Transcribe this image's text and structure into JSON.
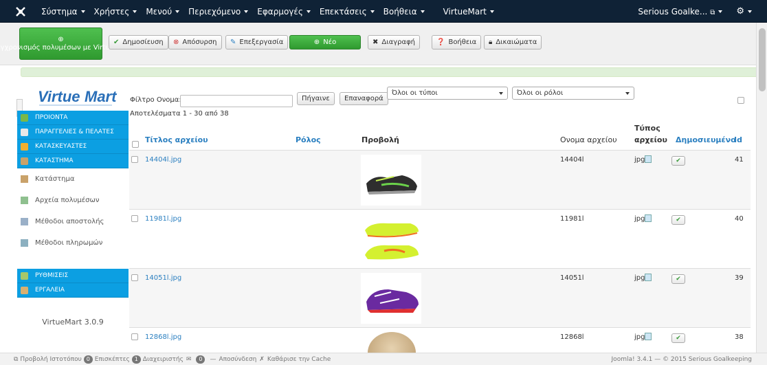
{
  "topbar": {
    "menu": [
      "Σύστημα",
      "Χρήστες",
      "Μενού",
      "Περιεχόμενο",
      "Εφαρμογές",
      "Επεκτάσεις",
      "Βοήθεια",
      "VirtueMart"
    ],
    "user": "Serious Goalke...",
    "colors": {
      "bar": "#0f2236"
    }
  },
  "toolbar": {
    "sync_label": "Συγχρονισμός πολυμέσων με VirtueMart",
    "publish": "Δημοσίευση",
    "unpublish": "Απόσυρση",
    "edit": "Επεξεργασία",
    "new": "Νέο",
    "delete": "Διαγραφή",
    "help": "Βοήθεια",
    "permissions": "Δικαιώματα"
  },
  "sidebar": {
    "logo": "VirtueMart",
    "sections": [
      "ΠΡΟΙΟΝΤΑ",
      "ΠΑΡΑΓΓΕΛΙΕΣ & ΠΕΛΑΤΕΣ",
      "ΚΑΤΑΣΚΕΥΑΣΤΕΣ",
      "ΚΑΤΑΣΤΗΜΑ"
    ],
    "store_items": [
      "Κατάστημα",
      "Αρχεία πολυμέσων",
      "Μέθοδοι αποστολής",
      "Μέθοδοι πληρωμών"
    ],
    "bottom_sections": [
      "ΡΥΘΜΙΣΕΙΣ",
      "ΕΡΓΑΛΕΙΑ"
    ],
    "version": "VirtueMart 3.0.9",
    "accent": "#0c9fe2"
  },
  "filter": {
    "label": "Φίλτρο Ονομα:",
    "value": "",
    "go": "Πήγαινε",
    "reset": "Επαναφορά",
    "type_select": "Όλοι οι τύποι",
    "role_select": "Όλοι οι ρόλοι",
    "results": "Αποτελέσματα 1 - 30 από 38"
  },
  "table": {
    "headers": {
      "title": "Τίτλος αρχείου",
      "role": "Ρόλος",
      "preview": "Προβολή",
      "filename": "Ονομα αρχείου",
      "type_line1": "Τύπος",
      "type_line2": "αρχείου",
      "published": "Δημοσιευμένο",
      "id": "Id"
    },
    "rows": [
      {
        "title": "14404l.jpg",
        "filename": "14404l",
        "type": "jpg",
        "id": "41"
      },
      {
        "title": "11981l.jpg",
        "filename": "11981l",
        "type": "jpg",
        "id": "40"
      },
      {
        "title": "14051l.jpg",
        "filename": "14051l",
        "type": "jpg",
        "id": "39"
      },
      {
        "title": "12868l.jpg",
        "filename": "12868l",
        "type": "jpg",
        "id": "38"
      }
    ]
  },
  "footer": {
    "view_site": "Προβολή Ιστοτόπου",
    "visitors_count": "0",
    "visitors": "Επισκέπτες",
    "admins_count": "1",
    "admins": "Διαχειριστής",
    "messages_count": "0",
    "logout": "Αποσύνδεση",
    "clear_cache": "Καθάρισε την Cache",
    "copyright": "Joomla! 3.4.1 — © 2015 Serious Goalkeeping"
  }
}
